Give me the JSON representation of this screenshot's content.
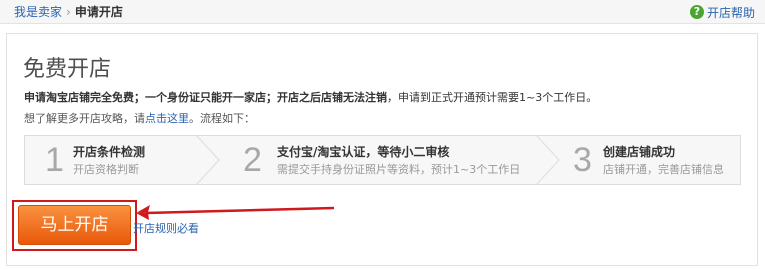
{
  "breadcrumb": {
    "home": "我是卖家",
    "separator": "›",
    "current": "申请开店"
  },
  "help": {
    "icon": "question-icon",
    "label": "开店帮助",
    "color": "#4aa630"
  },
  "main": {
    "title": "免费开店",
    "desc_bold": "申请淘宝店铺完全免费；一个身份证只能开一家店；开店之后店铺无法注销",
    "desc_rest": "，申请到正式开通预计需要1~3个工作日。",
    "guide_prefix": "想了解更多开店攻略，请",
    "guide_link": "点击这里",
    "guide_suffix": "。流程如下："
  },
  "steps": [
    {
      "num": "1",
      "title": "开店条件检测",
      "sub": "开店资格判断"
    },
    {
      "num": "2",
      "title": "支付宝/淘宝认证，等待小二审核",
      "sub": "需提交手持身份证照片等资料，预计1~3个工作日"
    },
    {
      "num": "3",
      "title": "创建店铺成功",
      "sub": "店铺开通，完善店铺信息"
    }
  ],
  "actions": {
    "open_label": "马上开店",
    "rules_label": "开店规则必看"
  },
  "colors": {
    "accent": "#f27a28",
    "highlight": "#d0181d",
    "link": "#2a63b0"
  }
}
